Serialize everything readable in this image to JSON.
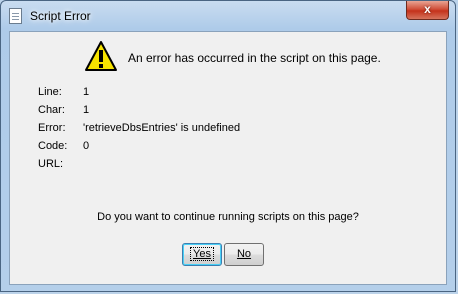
{
  "window": {
    "title": "Script Error",
    "close_glyph": "x"
  },
  "dialog": {
    "message": "An error has occurred in the script on this page.",
    "fields": [
      {
        "label": "Line:",
        "value": "1"
      },
      {
        "label": "Char:",
        "value": "1"
      },
      {
        "label": "Error:",
        "value": "'retrieveDbsEntries' is undefined"
      },
      {
        "label": "Code:",
        "value": "0"
      },
      {
        "label": "URL:",
        "value": ""
      }
    ],
    "question": "Do you want to continue running scripts on this page?",
    "buttons": {
      "yes": "Yes",
      "no": "No"
    }
  },
  "icons": {
    "title": "document-icon",
    "warning": "warning-icon",
    "close": "close-icon"
  },
  "colors": {
    "warning_fill": "#f7e300",
    "warning_stroke": "#000000",
    "close_red": "#c4321b",
    "default_button_border": "#3c7fb1"
  }
}
